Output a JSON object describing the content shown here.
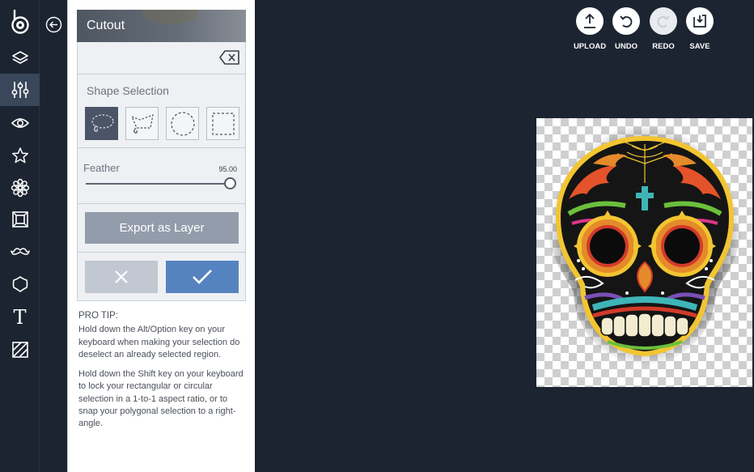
{
  "colors": {
    "app_bg": "#1c2431",
    "rail_active": "#3a465a",
    "panel_bg": "#eef0f3",
    "export_btn": "#939cab",
    "cancel_btn": "#c2c8d2",
    "apply_btn": "#5583bf",
    "skull_yellow": "#f2c531"
  },
  "sidebar": {
    "items": [
      {
        "icon": "logo-icon"
      },
      {
        "icon": "layers-icon"
      },
      {
        "icon": "sliders-icon",
        "active": true
      },
      {
        "icon": "eye-icon"
      },
      {
        "icon": "star-icon"
      },
      {
        "icon": "flower-icon"
      },
      {
        "icon": "frame-icon"
      },
      {
        "icon": "mustache-icon"
      },
      {
        "icon": "shape-icon"
      },
      {
        "icon": "text-icon",
        "glyph": "T"
      },
      {
        "icon": "texture-icon"
      }
    ]
  },
  "back_icon": "arrow-left-circle-icon",
  "panel": {
    "title": "Cutout",
    "clear_icon": "backspace-icon",
    "shape_section_label": "Shape Selection",
    "shapes": [
      {
        "name": "freehand-lasso",
        "selected": true
      },
      {
        "name": "polygon-lasso",
        "selected": false
      },
      {
        "name": "ellipse",
        "selected": false
      },
      {
        "name": "rectangle",
        "selected": false
      }
    ],
    "feather_label": "Feather",
    "feather_value": "95.00",
    "feather_fraction": 1.0,
    "export_label": "Export as Layer",
    "cancel_icon": "close-icon",
    "apply_icon": "check-icon"
  },
  "tips": {
    "title": "PRO TIP:",
    "tip1": "Hold down the Alt/Option key on your keyboard when making your selection do deselect an already selected region.",
    "tip2": "Hold down the Shift key on your keyboard to lock your rectangular or circular selection in a 1-to-1 aspect ratio, or to snap your polygonal selection to a right-angle."
  },
  "toolbar": {
    "upload": "UPLOAD",
    "undo": "UNDO",
    "redo": "REDO",
    "save": "SAVE",
    "redo_disabled": true
  },
  "canvas": {
    "subject": "sugar-skull-image",
    "background": "transparent-checkerboard"
  }
}
